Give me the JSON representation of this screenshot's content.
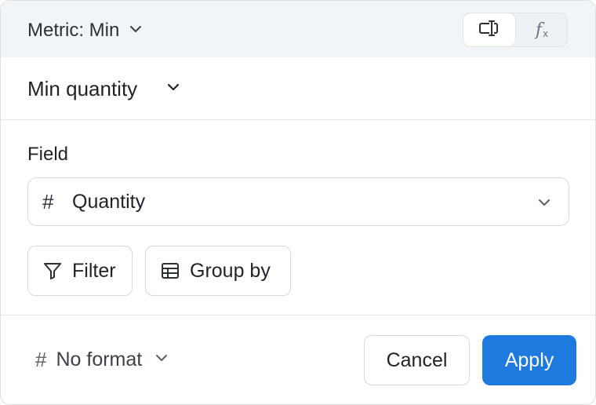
{
  "header": {
    "metric_label": "Metric: Min",
    "modes": [
      {
        "icon": "form-input-icon",
        "active": true
      },
      {
        "icon": "function-icon",
        "label": "f",
        "sub": "x",
        "active": false
      }
    ]
  },
  "name": {
    "value": "Min quantity"
  },
  "field": {
    "label": "Field",
    "type_icon": "hash-icon",
    "type_symbol": "#",
    "value": "Quantity"
  },
  "actions": {
    "filter_label": "Filter",
    "group_by_label": "Group by"
  },
  "footer": {
    "format_symbol": "#",
    "format_label": "No format",
    "cancel_label": "Cancel",
    "apply_label": "Apply"
  },
  "colors": {
    "accent": "#1f7ae0",
    "header_bg": "#f2f5f8",
    "border": "#d5d9de"
  }
}
